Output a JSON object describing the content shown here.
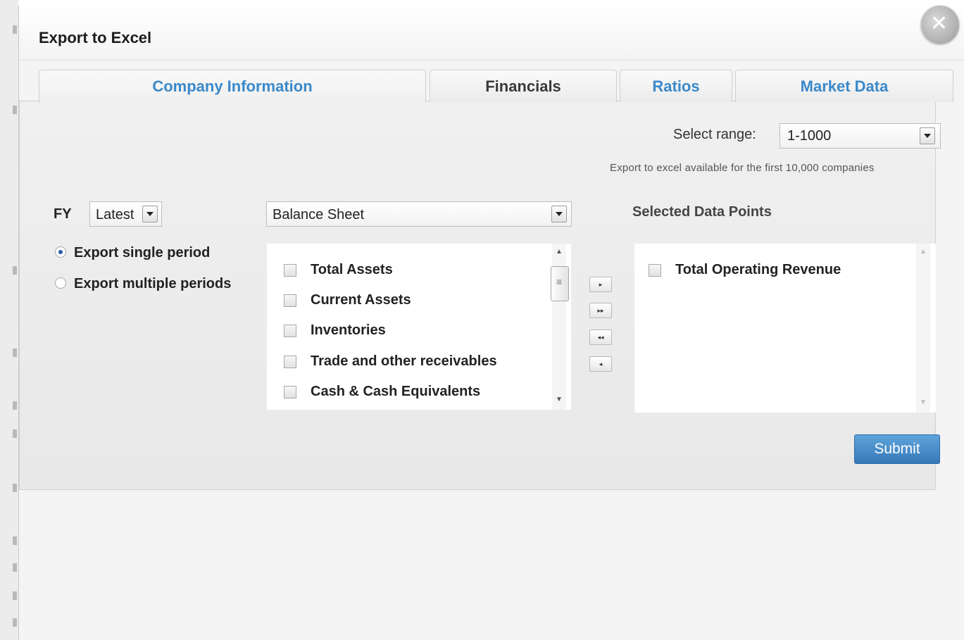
{
  "modal": {
    "title": "Export to Excel",
    "close_icon": "close-icon"
  },
  "tabs": [
    {
      "label": "Company Information",
      "active": true,
      "color": "#3a89c9"
    },
    {
      "label": "Financials",
      "active": false,
      "color": "#3a3a3a"
    },
    {
      "label": "Ratios",
      "active": false,
      "color": "#3a89c9"
    },
    {
      "label": "Market Data",
      "active": false,
      "color": "#3a89c9"
    }
  ],
  "range": {
    "label": "Select range:",
    "value": "1-1000",
    "note": "Export to excel available for the first 10,000 companies"
  },
  "fy": {
    "label": "FY",
    "value": "Latest"
  },
  "periods": [
    {
      "label": "Export single period",
      "selected": true
    },
    {
      "label": "Export multiple periods",
      "selected": false
    }
  ],
  "category": {
    "value": "Balance Sheet"
  },
  "available_items": [
    "Total Assets",
    "Current Assets",
    "Inventories",
    "Trade and other receivables",
    "Cash & Cash Equivalents"
  ],
  "move_buttons": {
    "add_one": "▸",
    "add_all": "▸▸",
    "remove_all": "◂◂",
    "remove_one": "◂"
  },
  "selected": {
    "label": "Selected Data Points",
    "items": [
      "Total Operating Revenue"
    ]
  },
  "submit_label": "Submit",
  "colors": {
    "accent": "#3a89c9",
    "submit": "#4a8fcc"
  }
}
